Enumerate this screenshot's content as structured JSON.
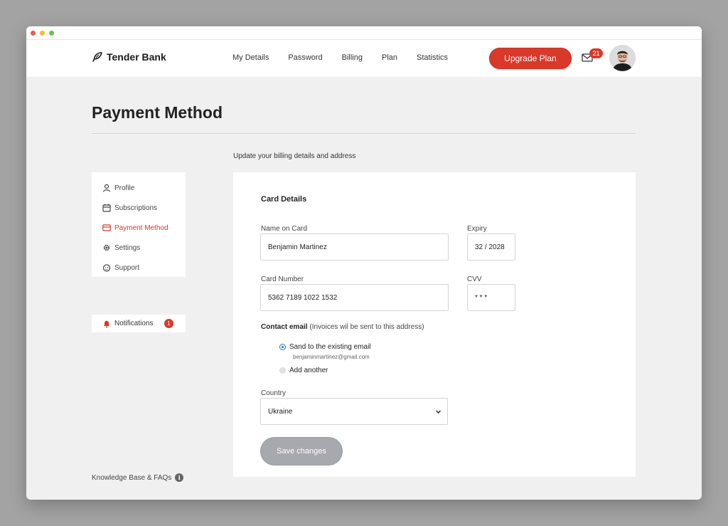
{
  "brand": {
    "name": "Tender Bank"
  },
  "nav": {
    "links": [
      "My Details",
      "Password",
      "Billing",
      "Plan",
      "Statistics"
    ],
    "upgrade_label": "Upgrade Plan",
    "mail_count": "21"
  },
  "page": {
    "title": "Payment Method",
    "subtitle": "Update your billing details and address"
  },
  "sidebar": {
    "items": [
      {
        "label": "Profile",
        "icon": "user-icon"
      },
      {
        "label": "Subscriptions",
        "icon": "calendar-icon"
      },
      {
        "label": "Payment Method",
        "icon": "credit-card-icon",
        "active": true
      },
      {
        "label": "Settings",
        "icon": "gear-icon"
      },
      {
        "label": "Support",
        "icon": "support-icon"
      }
    ],
    "notifications_label": "Notifications",
    "notifications_count": "1",
    "knowledge_base": "Knowledge Base & FAQs"
  },
  "form": {
    "card_title": "Card Details",
    "name_label": "Name on Card",
    "name_value": "Benjamin Martinez",
    "expiry_label": "Expiry",
    "expiry_value": "32 / 2028",
    "card_number_label": "Card Number",
    "card_number_value": "5362  7189  1022  1532",
    "cvv_label": "CVV",
    "cvv_value": "* * *",
    "contact_label": "Contact email",
    "contact_note": "(Invoices wil be sent to this address)",
    "email_option_1": "Sand to the existing email",
    "email_option_1_sub": "benjaminmartinez@gmail.com",
    "email_option_2": "Add another",
    "country_label": "Country",
    "country_value": "Ukraine",
    "save_label": "Save changes"
  },
  "colors": {
    "accent": "#d9392b",
    "radio": "#1f6fd1",
    "disabled": "#a6a9ad"
  }
}
